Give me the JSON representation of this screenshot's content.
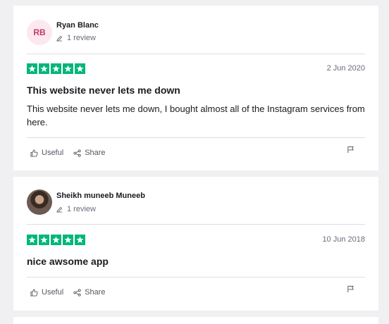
{
  "reviews": [
    {
      "initials": "RB",
      "name": "Ryan Blanc",
      "review_count": "1 review",
      "rating": 5,
      "date": "2 Jun 2020",
      "title": "This website never lets me down",
      "body": "This website never lets me down, I bought almost all of the Instagram services from here.",
      "useful_label": "Useful",
      "share_label": "Share"
    },
    {
      "initials": "",
      "name": "Sheikh muneeb Muneeb",
      "review_count": "1 review",
      "rating": 5,
      "date": "10 Jun 2018",
      "title": "nice awsome app",
      "body": "",
      "useful_label": "Useful",
      "share_label": "Share"
    }
  ],
  "colors": {
    "star_green": "#00b67a",
    "avatar_bg": "#fde8ef",
    "avatar_text": "#c0396b"
  }
}
